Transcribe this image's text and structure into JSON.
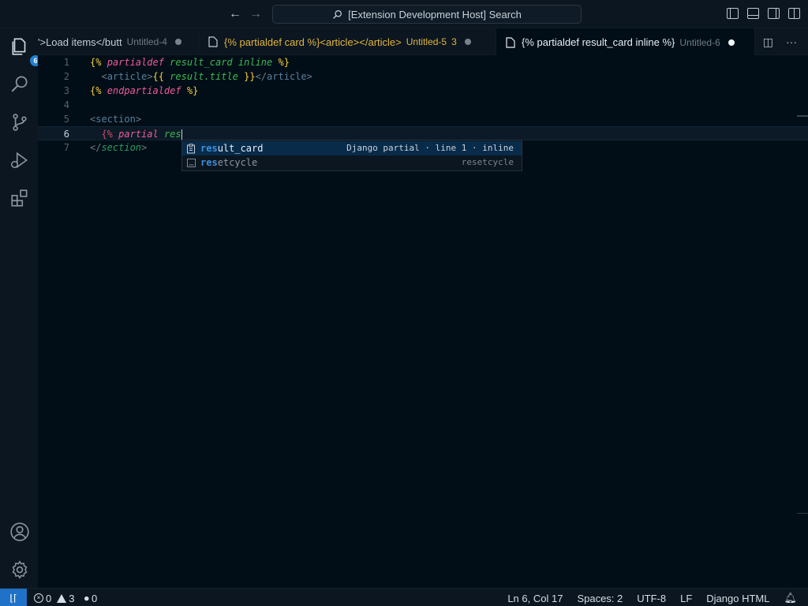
{
  "titlebar": {
    "search_text": "[Extension Development Host] Search"
  },
  "activity": {
    "explorer_badge": "6"
  },
  "tabs": [
    {
      "name": "'>Load items</butt",
      "desc": "Untitled-4"
    },
    {
      "name": "{% partialdef card %}<article></article>",
      "desc": "Untitled-5",
      "count": "3"
    },
    {
      "name": "{% partialdef result_card inline %}",
      "desc": "Untitled-6"
    }
  ],
  "editor": {
    "line_numbers": [
      "1",
      "2",
      "3",
      "4",
      "5",
      "6",
      "7"
    ],
    "l1": {
      "open": "{%",
      "kw": "partialdef",
      "name": "result_card",
      "mod": "inline",
      "close": "%}"
    },
    "l2": {
      "indent": "  ",
      "lt1": "<",
      "tag1": "article",
      "gt1": ">",
      "open": "{{",
      "var": "result",
      "dot": ".",
      "prop": "title",
      "close": "}}",
      "lt2": "</",
      "tag2": "article",
      "gt2": ">"
    },
    "l3": {
      "open": "{%",
      "kw": "endpartialdef",
      "close": "%}"
    },
    "l5": {
      "lt": "<",
      "tag": "section",
      "gt": ">"
    },
    "l6": {
      "indent": "  ",
      "open": "{%",
      "kw": "partial",
      "typed": "res"
    },
    "l7": {
      "lt": "</",
      "tag": "section",
      "gt": ">"
    }
  },
  "suggest": [
    {
      "match": "res",
      "rest": "ult_card",
      "detail": "Django partial · line 1 · inline",
      "icon": "snippet-icon"
    },
    {
      "match": "res",
      "rest": "etcycle",
      "detail": "resetcycle",
      "icon": "keyword-icon"
    }
  ],
  "status": {
    "errors": "0",
    "warnings": "3",
    "ports": "0",
    "position": "Ln 6, Col 17",
    "spaces": "Spaces: 2",
    "encoding": "UTF-8",
    "eol": "LF",
    "language": "Django HTML"
  },
  "colors": {
    "accent": "#1f72c7",
    "background": "#010e17",
    "tab_warning": "#e2b53e"
  }
}
